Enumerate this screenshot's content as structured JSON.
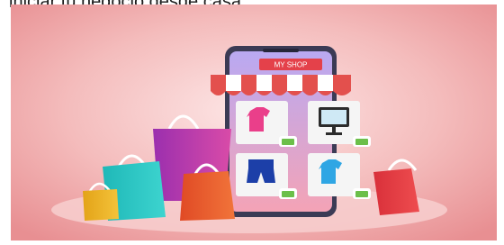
{
  "caption": {
    "text": "iniciar tu negocio desde casa."
  },
  "illustration": {
    "shop_sign": "MY SHOP",
    "products": [
      {
        "icon": "tshirt-pink-icon"
      },
      {
        "icon": "monitor-icon"
      },
      {
        "icon": "shorts-icon"
      },
      {
        "icon": "tshirt-blue-icon"
      }
    ],
    "bag_icons": [
      "bag-purple-icon",
      "bag-teal-icon",
      "bag-yellow-icon",
      "bag-orange-icon",
      "bag-red-icon"
    ],
    "colors": {
      "background": "#f2b6b6",
      "phone_body": "#3b3b55",
      "awning_red": "#e3504d",
      "accent_basket": "#6cbf4a"
    }
  }
}
